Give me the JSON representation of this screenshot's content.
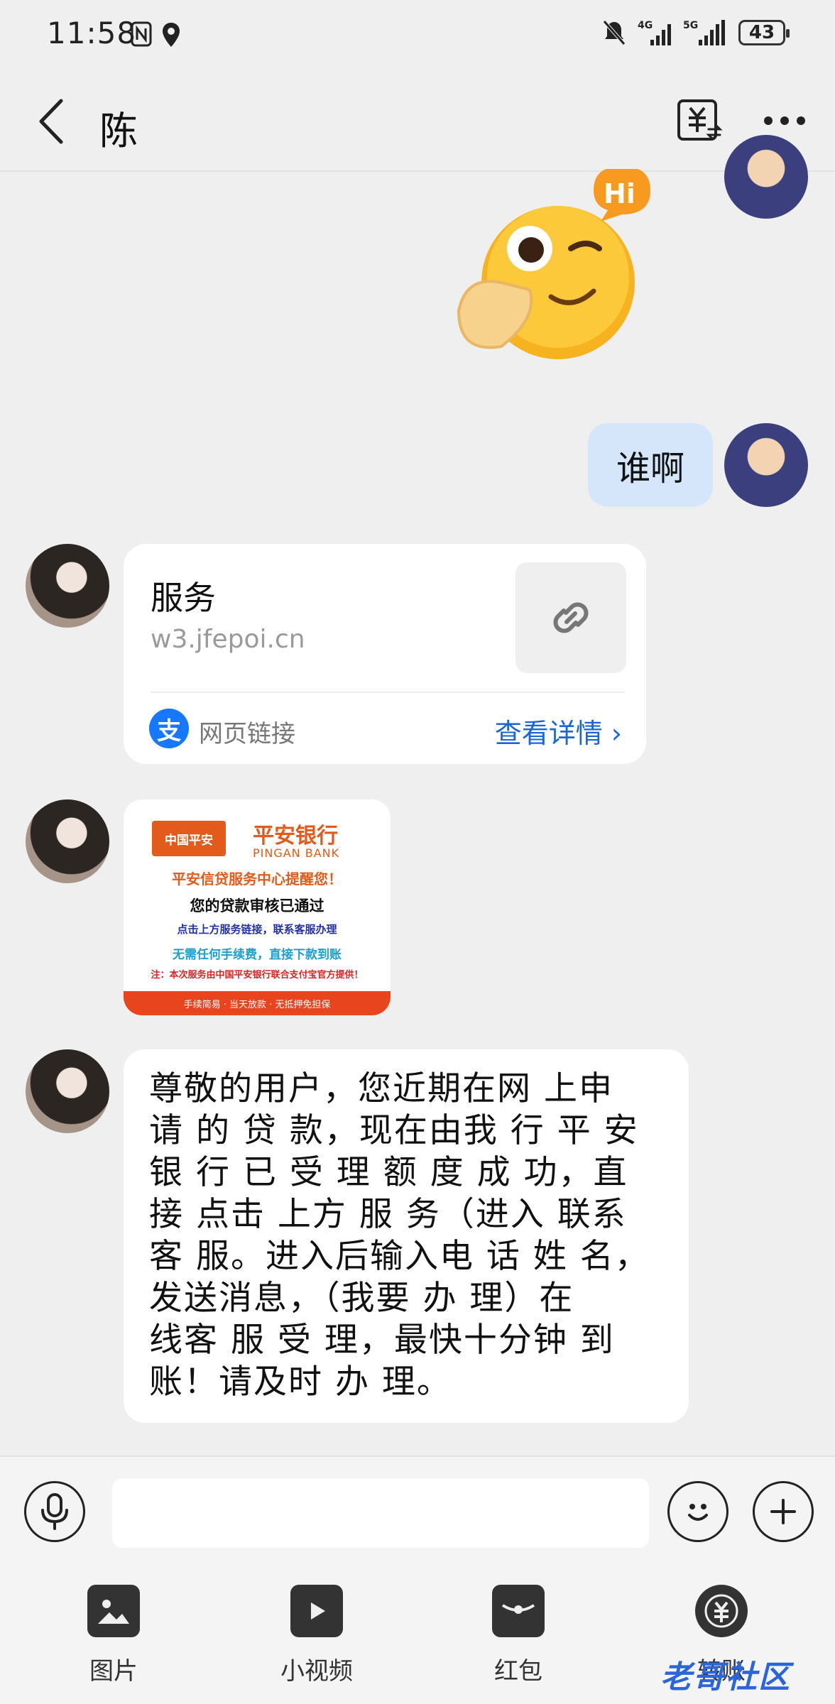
{
  "status_bar": {
    "time": "11:58",
    "battery": "43"
  },
  "header": {
    "title": "陈"
  },
  "messages": {
    "me_text": "谁啊",
    "link_card": {
      "title": "服务",
      "url": "w3.jfepoi.cn",
      "type_label": "网页链接",
      "action_label": "查看详情"
    },
    "image_card": {
      "logo_left": "中国平安",
      "logo_right": "平安银行",
      "logo_right_en": "PINGAN BANK",
      "line1": "平安信贷服务中心提醒您！",
      "line2": "您的贷款审核已通过",
      "line3": "点击上方服务链接，联系客服办理",
      "line4": "无需任何手续费，直接下款到账",
      "line5": "注：本次服务由中国平安银行联合支付宝官方提供！",
      "strip": "手续简易 · 当天放款 · 无抵押免担保"
    },
    "long_text_lines": [
      "尊敬的用户，您近期在网 上申",
      "请 的 贷 款，现在由我 行 平 安",
      "银 行 已 受 理 额 度 成 功，直",
      "接 点击 上方 服 务（进入 联系",
      "客 服。进入后输入电 话 姓 名，",
      "发送消息，（我要 办 理）在",
      "线客 服 受 理，最快十分钟 到",
      "账！请及时 办 理。"
    ]
  },
  "toolbar": {
    "photo": "图片",
    "video": "小视频",
    "red_packet": "红包",
    "transfer": "转账"
  },
  "watermark": "老哥社区"
}
